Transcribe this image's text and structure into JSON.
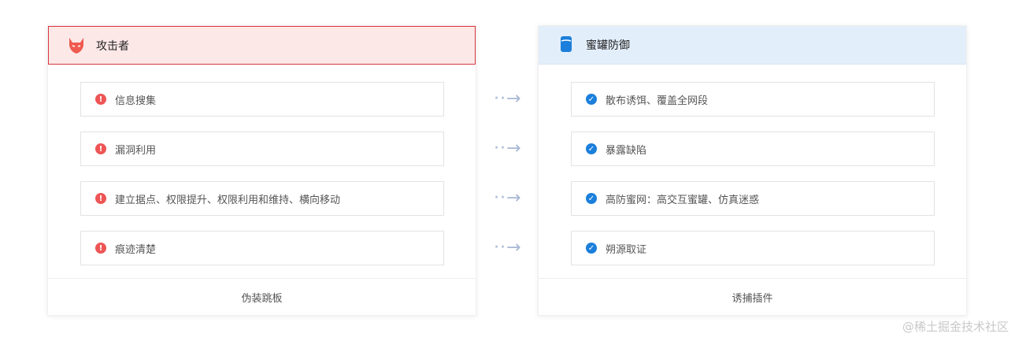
{
  "attacker": {
    "title": "攻击者",
    "icon": "devil-icon",
    "items": [
      "信息搜集",
      "漏洞利用",
      "建立据点、权限提升、权限利用和维持、横向移动",
      "痕迹清楚"
    ],
    "footer": "伪装跳板"
  },
  "defense": {
    "title": "蜜罐防御",
    "icon": "honeypot-icon",
    "items": [
      "散布诱饵、覆盖全网段",
      "暴露缺陷",
      "高防蜜网：高交互蜜罐、仿真迷惑",
      "朔源取证"
    ],
    "footer": "诱捕插件"
  },
  "watermark": "@稀土掘金技术社区"
}
